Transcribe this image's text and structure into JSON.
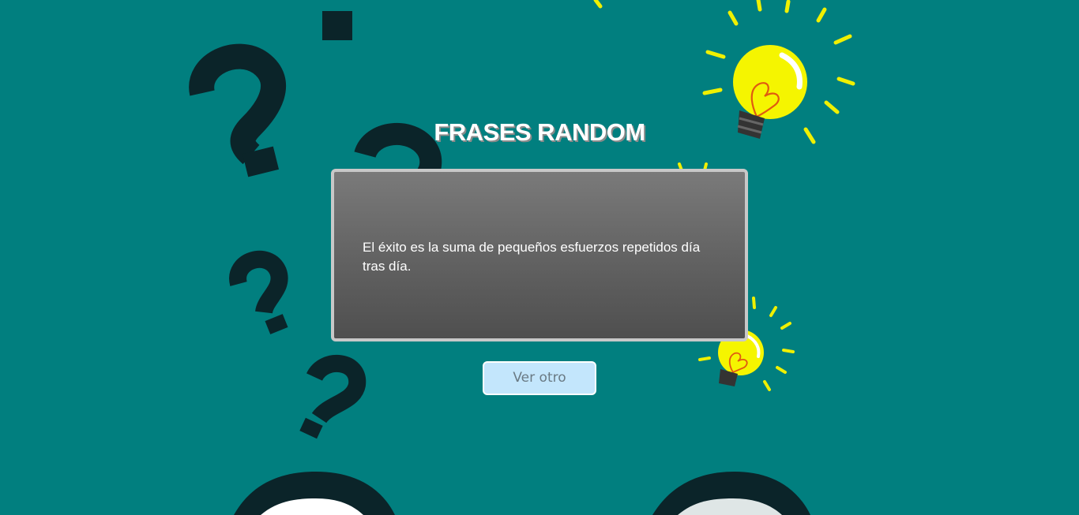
{
  "header": {
    "title": "FRASES RANDOM"
  },
  "quote_card": {
    "text": "El éxito es la suma de pequeños esfuerzos repetidos día tras día."
  },
  "actions": {
    "next_label": "Ver otro"
  },
  "colors": {
    "background": "#017f7f",
    "decoration_dark": "#0b2429",
    "bulb_yellow": "#f5f500",
    "button_bg": "#c3e6fc"
  }
}
